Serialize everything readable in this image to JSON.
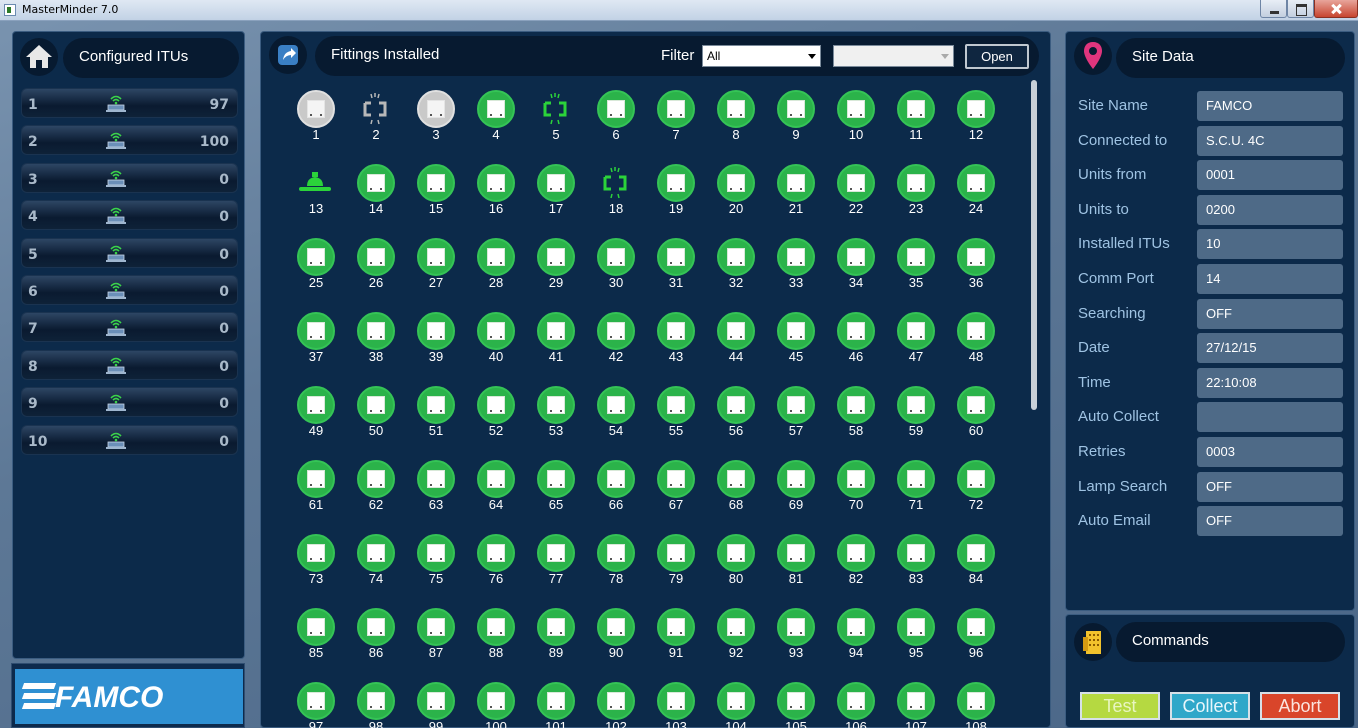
{
  "window": {
    "title": "MasterMinder 7.0"
  },
  "left_panel": {
    "title": "Configured ITUs",
    "itus": [
      {
        "num": "1",
        "value": "97"
      },
      {
        "num": "2",
        "value": "100"
      },
      {
        "num": "3",
        "value": "0"
      },
      {
        "num": "4",
        "value": "0"
      },
      {
        "num": "5",
        "value": "0"
      },
      {
        "num": "6",
        "value": "0"
      },
      {
        "num": "7",
        "value": "0"
      },
      {
        "num": "8",
        "value": "0"
      },
      {
        "num": "9",
        "value": "0"
      },
      {
        "num": "10",
        "value": "0"
      }
    ],
    "logo": "FAMCO"
  },
  "middle_panel": {
    "title": "Fittings Installed",
    "filter_label": "Filter",
    "filter_value": "All",
    "second_select_value": "",
    "open_label": "Open",
    "fittings": {
      "count": 108,
      "columns": 12,
      "grey": [
        1,
        3
      ],
      "broken_grey": [
        2
      ],
      "broken_green": [
        5,
        18
      ],
      "lamp_green": [
        13
      ]
    }
  },
  "right_panel": {
    "title": "Site Data",
    "rows": [
      {
        "label": "Site Name",
        "value": "FAMCO"
      },
      {
        "label": "Connected to",
        "value": "S.C.U. 4C"
      },
      {
        "label": "Units from",
        "value": "0001"
      },
      {
        "label": "Units to",
        "value": "0200"
      },
      {
        "label": "Installed ITUs",
        "value": "10"
      },
      {
        "label": "Comm Port",
        "value": "14"
      },
      {
        "label": "Searching",
        "value": "OFF"
      },
      {
        "label": "Date",
        "value": "27/12/15"
      },
      {
        "label": "Time",
        "value": "22:10:08"
      },
      {
        "label": "Auto Collect",
        "value": ""
      },
      {
        "label": "Retries",
        "value": "0003"
      },
      {
        "label": "Lamp Search",
        "value": "OFF"
      },
      {
        "label": "Auto Email",
        "value": "OFF"
      }
    ]
  },
  "commands": {
    "title": "Commands",
    "test_label": "Test",
    "collect_label": "Collect",
    "abort_label": "Abort",
    "test_color": "#b5d941",
    "collect_color": "#2fa7c9",
    "abort_color": "#d9452a"
  },
  "icons": {
    "left_header": "home-icon",
    "middle_header": "share-arrow-icon",
    "right_header": "map-pin-icon",
    "commands_header": "building-icon",
    "itu": "wireless-unit-icon",
    "fitting": "fitting-ok-icon"
  }
}
